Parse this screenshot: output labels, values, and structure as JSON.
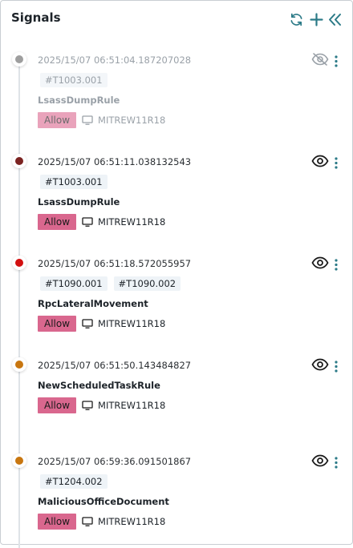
{
  "header": {
    "title": "Signals",
    "actions": [
      {
        "name": "refresh-icon"
      },
      {
        "name": "plus-icon"
      },
      {
        "name": "collapse-double-chevron-icon"
      }
    ]
  },
  "colors": {
    "accent": "#2b7a87",
    "allow": "#d9678e",
    "gray_dot": "#9e9e9e",
    "dark_red_dot": "#7b2321",
    "red_dot": "#d20f0f",
    "orange_dot": "#c8760f"
  },
  "signals": [
    {
      "timestamp": "2025/15/07 06:51:04.187207028",
      "tags": [
        "#T1003.001"
      ],
      "rule": "LsassDumpRule",
      "action": "Allow",
      "host": "MITREW11R18",
      "severity_color": "#9e9e9e",
      "eye_icon": "eye-off-icon",
      "faded": true
    },
    {
      "timestamp": "2025/15/07 06:51:11.038132543",
      "tags": [
        "#T1003.001"
      ],
      "rule": "LsassDumpRule",
      "action": "Allow",
      "host": "MITREW11R18",
      "severity_color": "#7b2321",
      "eye_icon": "eye-icon",
      "faded": false
    },
    {
      "timestamp": "2025/15/07 06:51:18.572055957",
      "tags": [
        "#T1090.001",
        "#T1090.002"
      ],
      "rule": "RpcLateralMovement",
      "action": "Allow",
      "host": "MITREW11R18",
      "severity_color": "#d20f0f",
      "eye_icon": "eye-icon",
      "faded": false
    },
    {
      "timestamp": "2025/15/07 06:51:50.143484827",
      "tags": [],
      "rule": "NewScheduledTaskRule",
      "action": "Allow",
      "host": "MITREW11R18",
      "severity_color": "#c8760f",
      "eye_icon": "eye-icon",
      "faded": false
    },
    {
      "timestamp": "2025/15/07 06:59:36.091501867",
      "tags": [
        "#T1204.002"
      ],
      "rule": "MaliciousOfficeDocument",
      "action": "Allow",
      "host": "MITREW11R18",
      "severity_color": "#c8760f",
      "eye_icon": "eye-icon",
      "faded": false
    }
  ]
}
